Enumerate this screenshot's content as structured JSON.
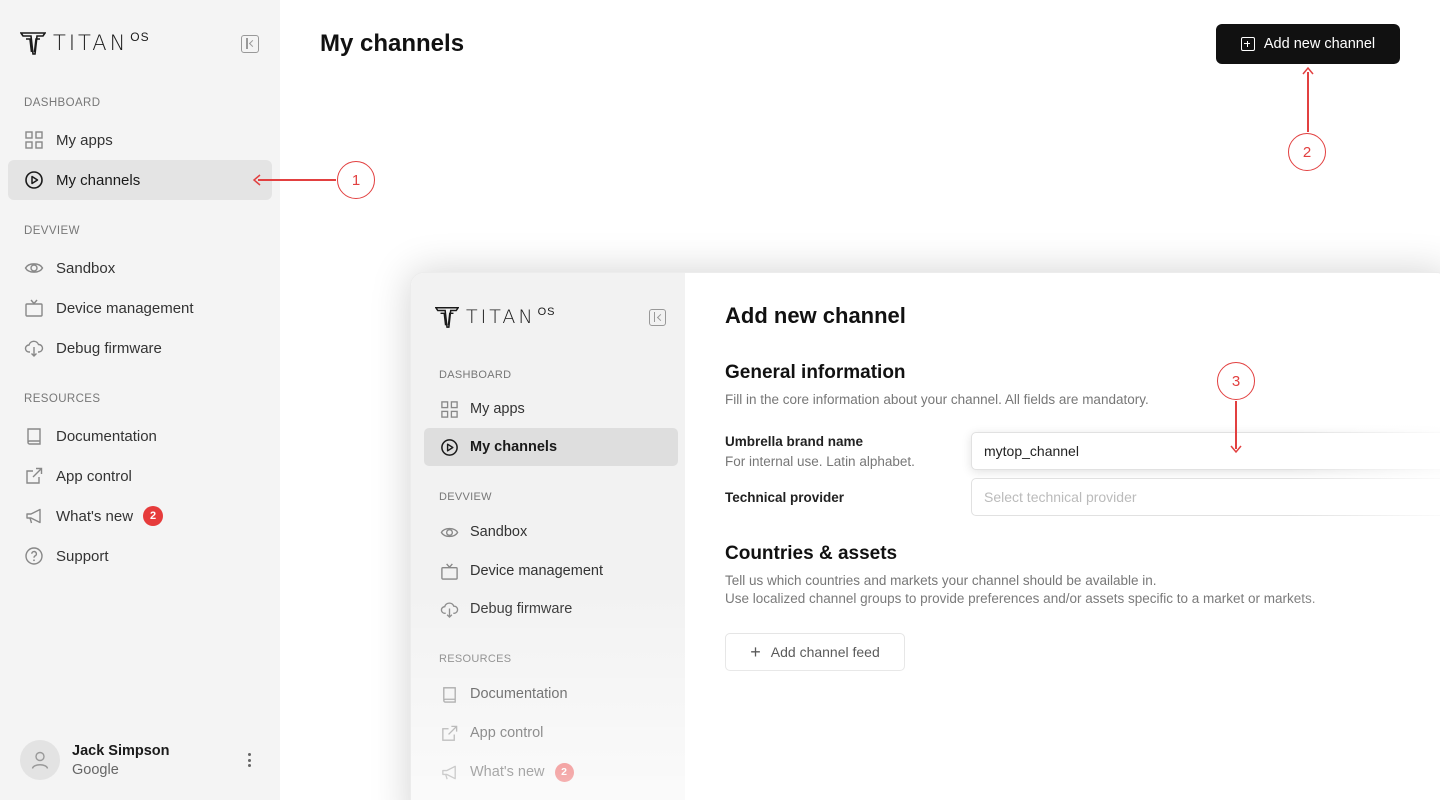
{
  "brand": {
    "name": "TITAN",
    "suffix": "OS"
  },
  "sidebar": {
    "sections": [
      {
        "title": "DASHBOARD",
        "items": [
          {
            "label": "My apps",
            "icon": "grid-icon"
          },
          {
            "label": "My channels",
            "icon": "play-circle-icon",
            "active": true
          }
        ]
      },
      {
        "title": "DEVVIEW",
        "items": [
          {
            "label": "Sandbox",
            "icon": "eye-icon"
          },
          {
            "label": "Device management",
            "icon": "tv-icon"
          },
          {
            "label": "Debug firmware",
            "icon": "cloud-download-icon"
          }
        ]
      },
      {
        "title": "RESOURCES",
        "items": [
          {
            "label": "Documentation",
            "icon": "book-icon"
          },
          {
            "label": "App control",
            "icon": "external-link-icon"
          },
          {
            "label": "What's new",
            "icon": "megaphone-icon",
            "badge": "2"
          },
          {
            "label": "Support",
            "icon": "help-circle-icon"
          }
        ]
      }
    ],
    "user": {
      "name": "Jack Simpson",
      "org": "Google"
    }
  },
  "main": {
    "title": "My channels",
    "add_button_label": "Add new channel"
  },
  "annotations": [
    "1",
    "2",
    "3"
  ],
  "preview": {
    "title": "Add new channel",
    "general": {
      "heading": "General information",
      "description": "Fill in the core information about your channel. All fields are mandatory.",
      "brand_label": "Umbrella brand name",
      "brand_sublabel": "For internal use. Latin alphabet.",
      "brand_value": "mytop_channel",
      "provider_label": "Technical provider",
      "provider_placeholder": "Select technical provider"
    },
    "countries": {
      "heading": "Countries & assets",
      "description_1": "Tell us which countries and markets your channel should be available in.",
      "description_2": "Use localized channel groups to provide preferences and/or assets specific to a market or markets."
    },
    "add_feed_label": "Add channel feed"
  },
  "colors": {
    "accent": "#111111",
    "annotation": "#e24040",
    "badge": "#e63b3b"
  }
}
